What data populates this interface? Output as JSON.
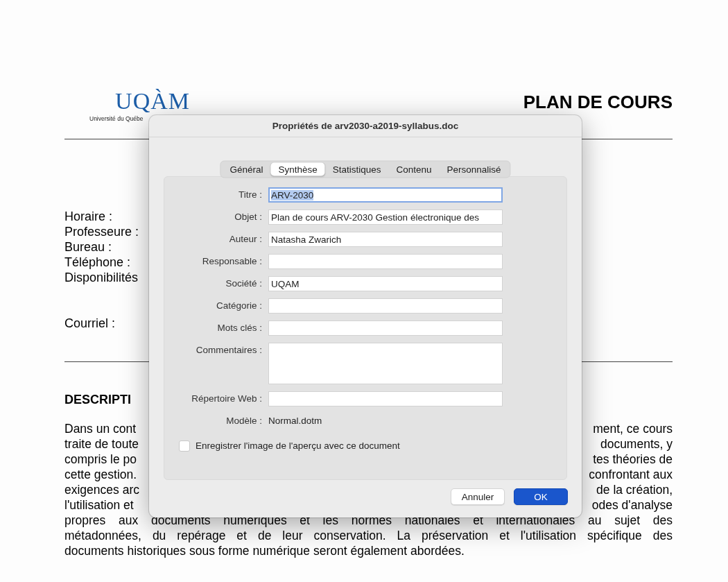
{
  "document": {
    "logo": {
      "wordmark": "UQÀM",
      "subtitle": "Université du Québe"
    },
    "title": "PLAN DE COURS",
    "info_labels": [
      "Horaire :",
      "Professeure :",
      "Bureau :",
      "Téléphone :",
      "Disponibilités"
    ],
    "email_label": "Courriel :",
    "section_heading": "DESCRIPTI",
    "paragraph_lines": [
      {
        "kind": "split",
        "left": "Dans un cont",
        "right": "ment, ce cours"
      },
      {
        "kind": "split",
        "left": "traite de toute",
        "right": "documents, y"
      },
      {
        "kind": "split",
        "left": "compris le po",
        "right": "tes théories de"
      },
      {
        "kind": "split",
        "left": "cette gestion.",
        "right": "confrontant aux"
      },
      {
        "kind": "split",
        "left": "exigences arc",
        "right": "de la création,"
      },
      {
        "kind": "split",
        "left": "l'utilisation et",
        "right": "odes d'analyse"
      },
      {
        "kind": "full",
        "text": "propres aux documents numériques et les normes nationales et internationales au sujet des"
      },
      {
        "kind": "full",
        "text": "métadonnées, du repérage et de leur conservation. La préservation et l'utilisation spécifique des"
      },
      {
        "kind": "last",
        "text": "documents historiques sous forme numérique seront également abordées."
      }
    ]
  },
  "dialog": {
    "title": "Propriétés de arv2030-a2019-syllabus.doc",
    "tabs": [
      {
        "label": "Général",
        "selected": false
      },
      {
        "label": "Synthèse",
        "selected": true
      },
      {
        "label": "Statistiques",
        "selected": false
      },
      {
        "label": "Contenu",
        "selected": false
      },
      {
        "label": "Personnalisé",
        "selected": false
      }
    ],
    "fields": [
      {
        "label": "Titre :",
        "kind": "text",
        "value": "ARV-2030",
        "focused": true
      },
      {
        "label": "Objet :",
        "kind": "text",
        "value": "Plan de cours ARV-2030 Gestion électronique des",
        "focused": false
      },
      {
        "label": "Auteur :",
        "kind": "text",
        "value": "Natasha Zwarich",
        "focused": false
      },
      {
        "label": "Responsable :",
        "kind": "text",
        "focused": false
      },
      {
        "label": "Société :",
        "kind": "text",
        "value": "UQAM",
        "focused": false
      },
      {
        "label": "Catégorie :",
        "kind": "text",
        "focused": false
      },
      {
        "label": "Mots clés :",
        "kind": "text",
        "focused": false
      },
      {
        "label": "Commentaires :",
        "kind": "textarea",
        "focused": false
      },
      {
        "label": "Répertoire Web :",
        "kind": "text",
        "focused": false
      },
      {
        "label": "Modèle :",
        "kind": "static",
        "value": "Normal.dotm"
      }
    ],
    "checkbox": {
      "label": "Enregistrer l'image de l'aperçu avec ce document",
      "checked": false
    },
    "buttons": [
      {
        "label": "Annuler",
        "kind": "cancel"
      },
      {
        "label": "OK",
        "kind": "default"
      }
    ]
  }
}
